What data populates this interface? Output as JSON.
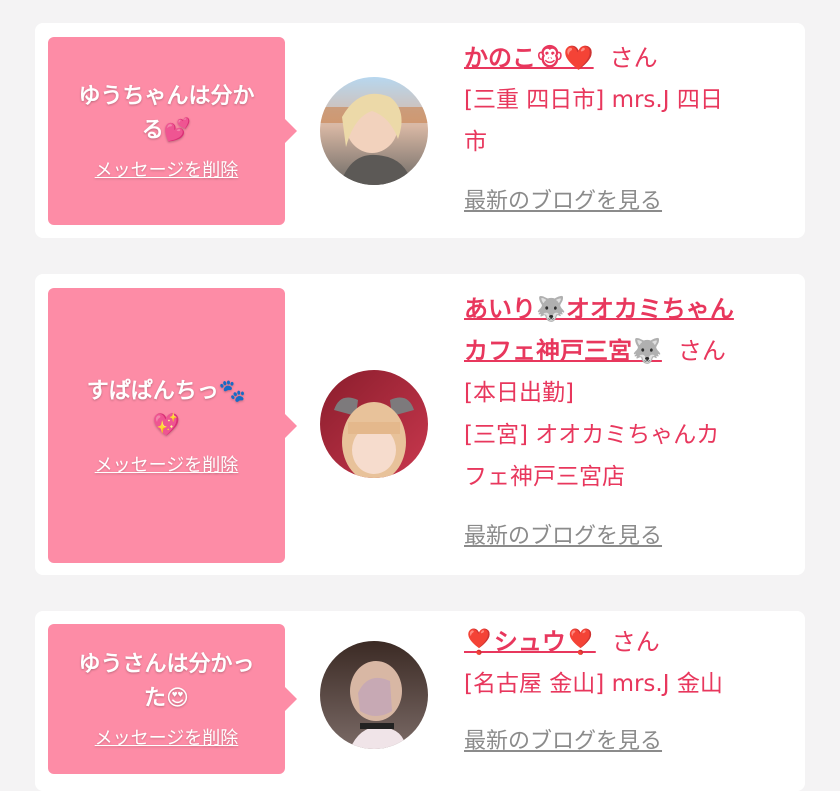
{
  "cards": [
    {
      "message_line1": "ゆうちゃんは分か",
      "message_line2": "る💕",
      "delete_label": "メッセージを削除",
      "name": "かのこ🐵❤️",
      "san": "さん",
      "details": [
        "[三重 四日市] mrs.J 四日",
        "市"
      ],
      "blog_label": "最新のブログを見る"
    },
    {
      "message_line1": "すぱぱんちっ🐾",
      "message_line2": "💖",
      "delete_label": "メッセージを削除",
      "name_line1": "あいり🐺オオカミちゃん",
      "name_line2": "カフェ神戸三宮🐺",
      "san": "さん",
      "details": [
        "[本日出勤]",
        "[三宮] オオカミちゃんカ",
        "フェ神戸三宮店"
      ],
      "blog_label": "最新のブログを見る"
    },
    {
      "message_line1": "ゆうさんは分かっ",
      "message_line2": "た😍",
      "delete_label": "メッセージを削除",
      "name": "❣️シュウ❣️",
      "san": "さん",
      "details": [
        "[名古屋 金山] mrs.J 金山"
      ],
      "blog_label": "最新のブログを見る"
    }
  ],
  "colors": {
    "bubble": "#fd8ca6",
    "accent": "#e8375d",
    "link_gray": "#8b8b8b",
    "background": "#f4f3f4"
  }
}
